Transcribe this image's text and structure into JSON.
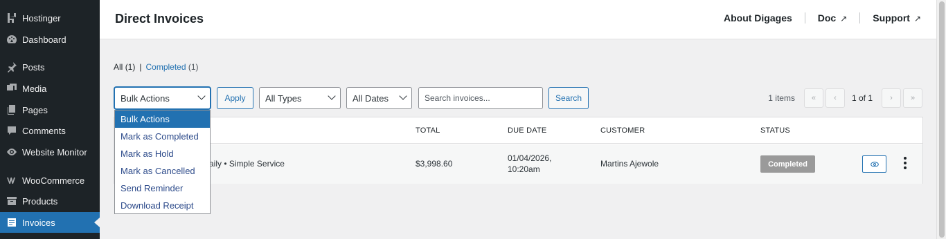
{
  "sidebar": {
    "items": [
      {
        "label": "Hostinger",
        "icon": "hostinger-icon"
      },
      {
        "label": "Dashboard",
        "icon": "dashboard-icon"
      },
      {
        "label": "Posts",
        "icon": "pin-icon"
      },
      {
        "label": "Media",
        "icon": "media-icon"
      },
      {
        "label": "Pages",
        "icon": "pages-icon"
      },
      {
        "label": "Comments",
        "icon": "comments-icon"
      },
      {
        "label": "Website Monitor",
        "icon": "eye-icon"
      },
      {
        "label": "WooCommerce",
        "icon": "woocommerce-icon"
      },
      {
        "label": "Products",
        "icon": "archive-icon"
      },
      {
        "label": "Invoices",
        "icon": "invoice-icon",
        "active": true
      }
    ]
  },
  "header": {
    "title": "Direct Invoices",
    "links": {
      "about": "About Digages",
      "doc": "Doc",
      "support": "Support",
      "external_glyph": "↗"
    }
  },
  "filters": {
    "all_label": "All",
    "all_count": "(1)",
    "separator": "|",
    "completed_label": "Completed",
    "completed_count": "(1)"
  },
  "toolbar": {
    "bulk_selected": "Bulk Actions",
    "apply_label": "Apply",
    "types_selected": "All Types",
    "dates_selected": "All Dates",
    "search_placeholder": "Search invoices...",
    "search_label": "Search"
  },
  "pagination": {
    "count": "1 items",
    "first": "«",
    "prev": "‹",
    "info": "1 of 1",
    "next": "›",
    "last": "»"
  },
  "table": {
    "columns": {
      "total": "TOTAL",
      "due_date": "DUE DATE",
      "customer": "CUSTOMER",
      "status": "STATUS"
    },
    "rows": [
      {
        "service": "aily • Simple Service",
        "total": "$3,998.60",
        "due_date_line1": "01/04/2026,",
        "due_date_line2": "10:20am",
        "customer": "Martins Ajewole",
        "status": "Completed"
      }
    ]
  },
  "bulk_dropdown": {
    "options": [
      "Bulk Actions",
      "Mark as Completed",
      "Mark as Hold",
      "Mark as Cancelled",
      "Send Reminder",
      "Download Receipt"
    ],
    "selected_index": 0
  },
  "colors": {
    "sidebar_bg": "#1d2327",
    "accent": "#2271b1",
    "status_completed_bg": "#9a9a9a"
  }
}
